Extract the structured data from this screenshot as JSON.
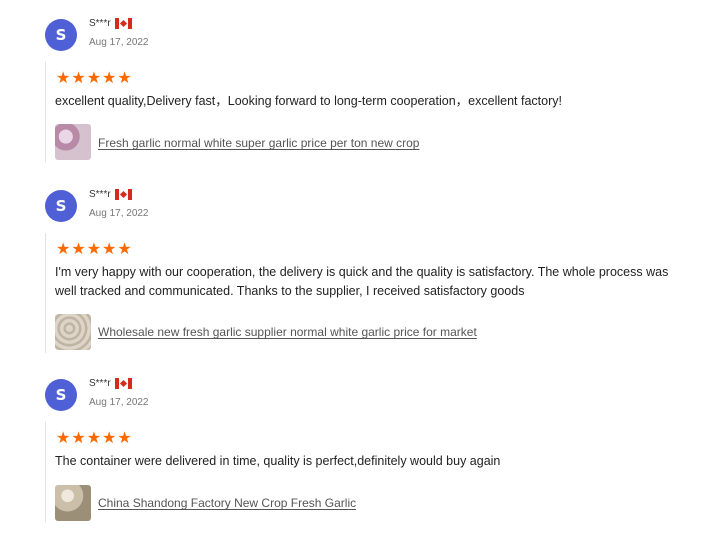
{
  "reviews": [
    {
      "avatar_letter": "S",
      "name": "S***r",
      "flag": "canada-flag-icon",
      "date": "Aug 17, 2022",
      "rating": 5,
      "text": "excellent quality,Delivery fast，Looking forward to long-term cooperation，excellent factory!",
      "product": "Fresh garlic normal white super garlic price per ton new crop"
    },
    {
      "avatar_letter": "S",
      "name": "S***r",
      "flag": "canada-flag-icon",
      "date": "Aug 17, 2022",
      "rating": 5,
      "text": "I'm very happy with our cooperation, the delivery is quick and the quality is satisfactory. The whole process was well tracked and communicated. Thanks to the supplier, I received satisfactory goods",
      "product": "Wholesale new fresh garlic supplier normal white garlic price for market"
    },
    {
      "avatar_letter": "S",
      "name": "S***r",
      "flag": "canada-flag-icon",
      "date": "Aug 17, 2022",
      "rating": 5,
      "text": "The container were delivered in time, quality is perfect,definitely would buy again",
      "product": "China Shandong Factory New Crop Fresh Garlic"
    }
  ],
  "colors": {
    "avatar": "#4f5fd6",
    "star": "#ff6a00",
    "flag_red": "#d52b1e"
  }
}
